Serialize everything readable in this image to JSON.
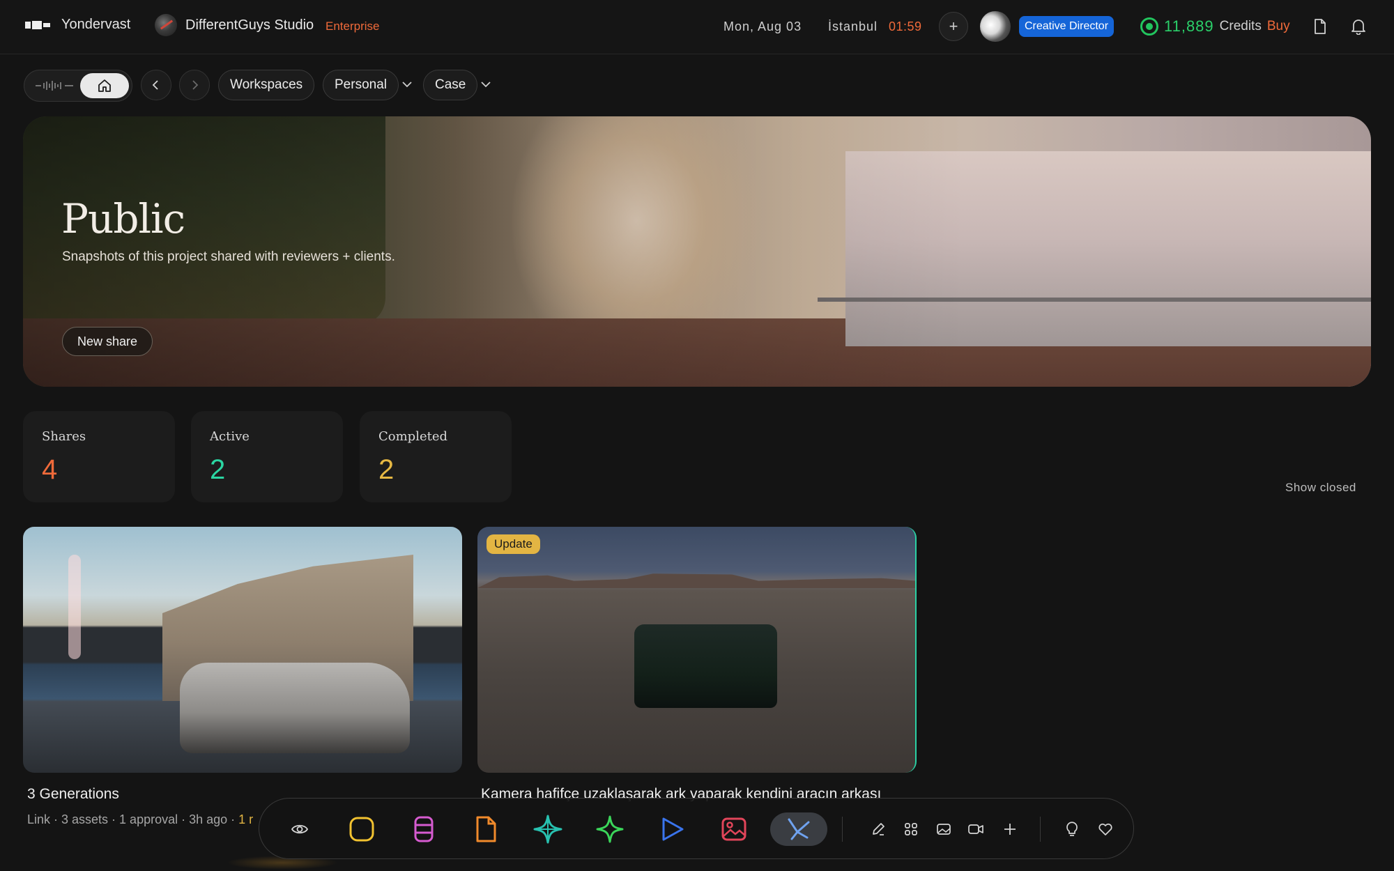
{
  "topbar": {
    "app_name": "Yondervast",
    "studio_name": "DifferentGuys Studio",
    "plan": "Enterprise",
    "date": "Mon, Aug 03",
    "city": "İstanbul",
    "time": "01:59",
    "role": "Creative Director",
    "credits": "11,889",
    "credits_label": "Credits",
    "buy_label": "Buy",
    "icons": [
      "plus-icon",
      "document-icon",
      "bell-icon"
    ]
  },
  "nav": {
    "home_icon": "home-icon",
    "back_icon": "chevron-left-icon",
    "forward_icon": "chevron-right-icon",
    "workspaces": "Workspaces",
    "personal": "Personal",
    "case": "Case"
  },
  "hero": {
    "title": "Public",
    "subtitle": "Snapshots of this project shared with reviewers + clients.",
    "button": "New share"
  },
  "stats": [
    {
      "label": "Shares",
      "value": "4",
      "color": "#ef6a3a"
    },
    {
      "label": "Active",
      "value": "2",
      "color": "#2bd6a2"
    },
    {
      "label": "Completed",
      "value": "2",
      "color": "#e6b843"
    }
  ],
  "filter": {
    "show_closed": "Show closed"
  },
  "cards": [
    {
      "title": "3 Generations",
      "meta": "Link · 3 assets · 1 approval · 3h ago · ",
      "meta_hl": "1 r",
      "badge": ""
    },
    {
      "title": "Kamera hafifçe uzaklaşarak ark yaparak kendini aracın arkası",
      "meta": "",
      "meta_hl": "",
      "badge": "Update"
    }
  ],
  "dock": {
    "items": [
      "eye-icon",
      "square-icon",
      "database-icon",
      "file-icon",
      "sparkle-icon",
      "star-icon",
      "play-icon",
      "image-icon",
      "graph-icon"
    ],
    "tools": [
      "edit-icon",
      "grid-icon",
      "picture-icon",
      "video-icon",
      "plus-icon",
      "bulb-icon",
      "heart-icon"
    ]
  },
  "colors": {
    "accent_orange": "#ef6a3a",
    "accent_green": "#2bd06a",
    "accent_blue": "#1565d8",
    "badge_yellow": "#e3b543"
  }
}
